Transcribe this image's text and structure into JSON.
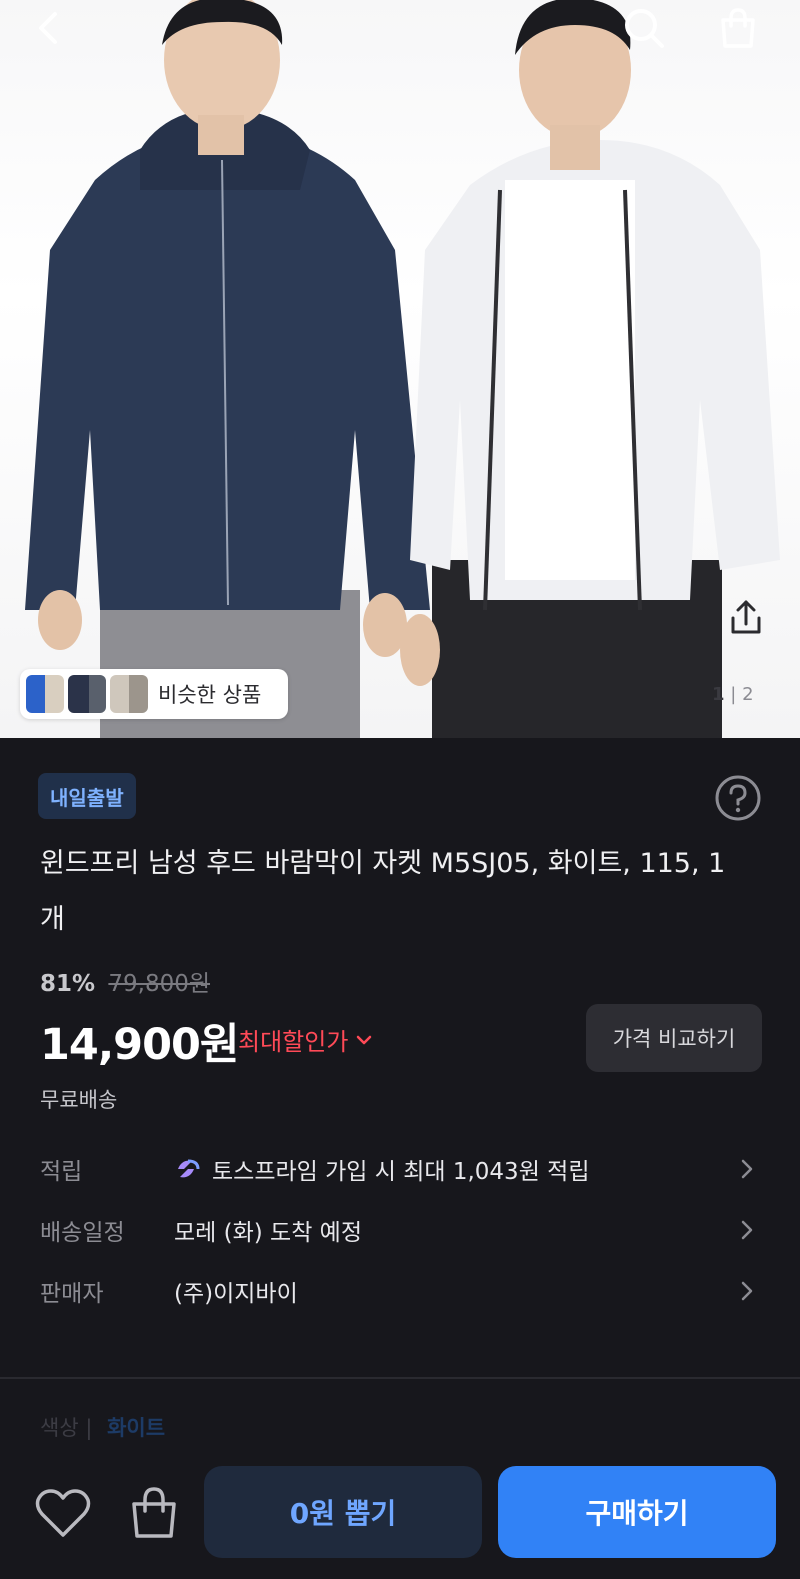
{
  "product_image": {
    "similar_label": "비슷한 상품",
    "page_current": "1",
    "page_separator": "|",
    "page_total": "2"
  },
  "badge": "내일출발",
  "title": "윈드프리 남성 후드 바람막이 자켓 M5SJ05, 화이트, 115, 1개",
  "pricing": {
    "discount_percent": "81%",
    "original_price": "79,800원",
    "price": "14,900원",
    "max_discount_label": "최대할인가",
    "compare_button": "가격 비교하기",
    "shipping": "무료배송"
  },
  "info_rows": [
    {
      "label": "적립",
      "value": "토스프라임 가입 시 최대 1,043원 적립",
      "icon": "toss-prime-icon"
    },
    {
      "label": "배송일정",
      "value": "모레 (화) 도착 예정"
    },
    {
      "label": "판매자",
      "value": "(주)이지바이"
    }
  ],
  "option": {
    "label": "색상",
    "separator": "|",
    "selected": "화이트"
  },
  "bottom_bar": {
    "draw_button": "0원 뽑기",
    "buy_button": "구매하기"
  },
  "colors": {
    "background": "#17171c",
    "accent_blue": "#3182f6",
    "discount_red": "#ff4a57",
    "badge_bg": "#20304a",
    "badge_text": "#7fb2ff"
  }
}
